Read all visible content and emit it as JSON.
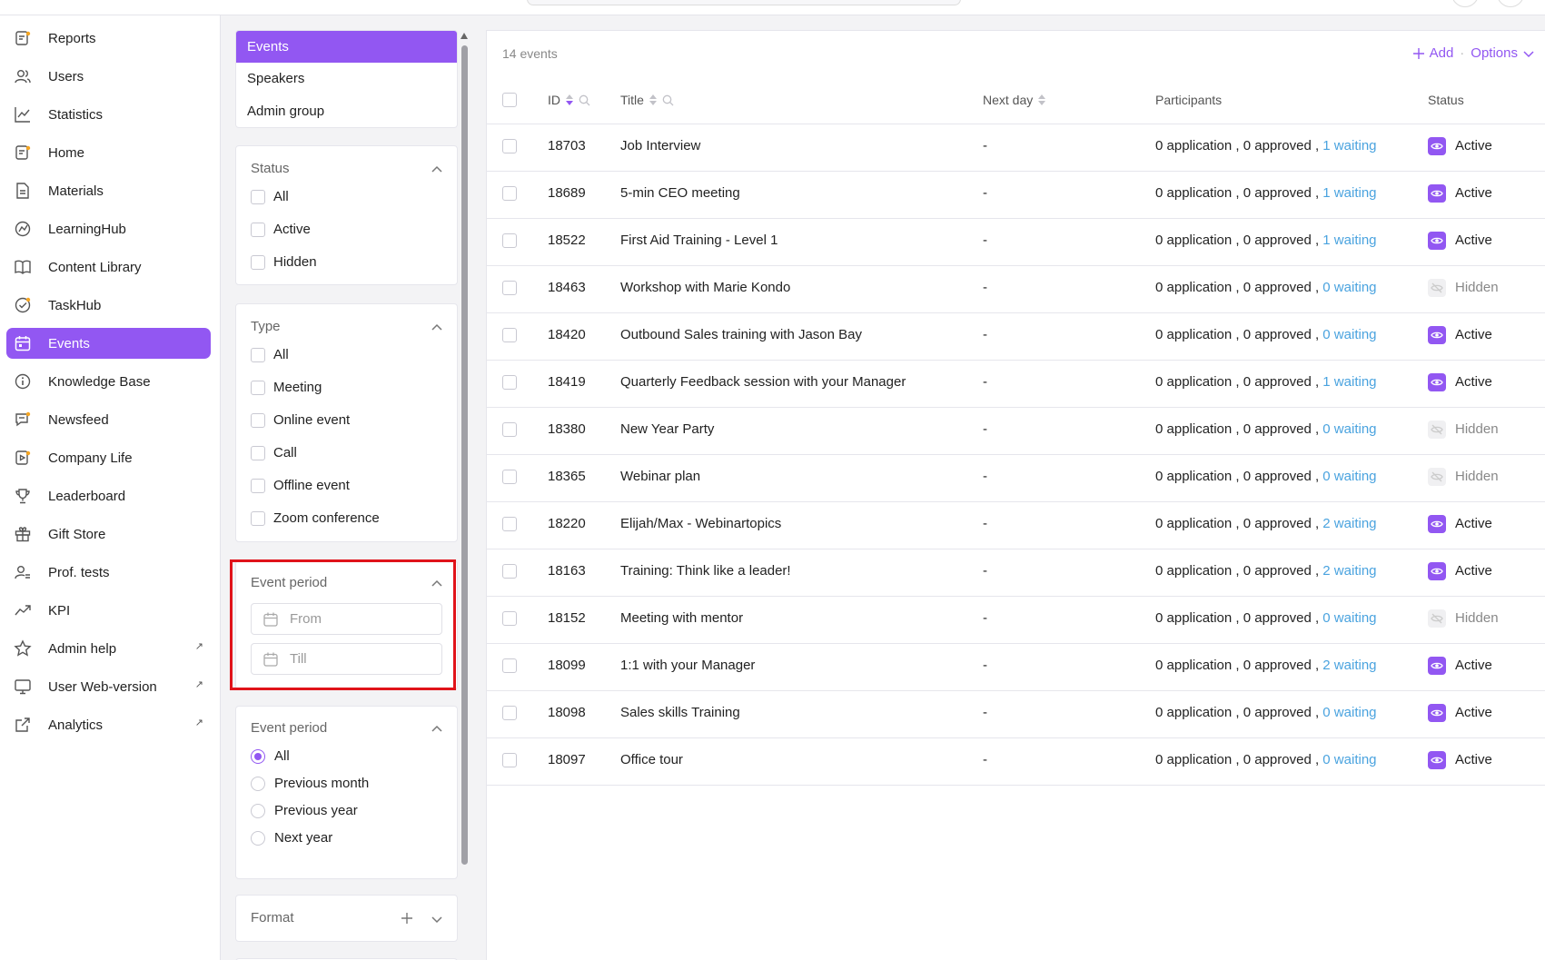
{
  "nav": [
    {
      "label": "Reports",
      "icon": "reports-icon",
      "active": false,
      "external": false
    },
    {
      "label": "Users",
      "icon": "users-icon",
      "active": false,
      "external": false
    },
    {
      "label": "Statistics",
      "icon": "statistics-icon",
      "active": false,
      "external": false
    },
    {
      "label": "Home",
      "icon": "home-icon",
      "active": false,
      "external": false
    },
    {
      "label": "Materials",
      "icon": "materials-icon",
      "active": false,
      "external": false
    },
    {
      "label": "LearningHub",
      "icon": "learninghub-icon",
      "active": false,
      "external": false
    },
    {
      "label": "Content Library",
      "icon": "book-icon",
      "active": false,
      "external": false
    },
    {
      "label": "TaskHub",
      "icon": "taskhub-icon",
      "active": false,
      "external": false
    },
    {
      "label": "Events",
      "icon": "calendar-icon",
      "active": true,
      "external": false
    },
    {
      "label": "Knowledge Base",
      "icon": "info-icon",
      "active": false,
      "external": false
    },
    {
      "label": "Newsfeed",
      "icon": "newsfeed-icon",
      "active": false,
      "external": false
    },
    {
      "label": "Company Life",
      "icon": "video-icon",
      "active": false,
      "external": false
    },
    {
      "label": "Leaderboard",
      "icon": "trophy-icon",
      "active": false,
      "external": false
    },
    {
      "label": "Gift Store",
      "icon": "gift-icon",
      "active": false,
      "external": false
    },
    {
      "label": "Prof. tests",
      "icon": "tests-icon",
      "active": false,
      "external": false
    },
    {
      "label": "KPI",
      "icon": "trend-icon",
      "active": false,
      "external": false
    },
    {
      "label": "Admin help",
      "icon": "star-icon",
      "active": false,
      "external": true
    },
    {
      "label": "User Web-version",
      "icon": "monitor-icon",
      "active": false,
      "external": true
    },
    {
      "label": "Analytics",
      "icon": "external-link-icon",
      "active": false,
      "external": true
    }
  ],
  "segments": [
    "Events",
    "Speakers",
    "Admin group"
  ],
  "filters": {
    "status": {
      "title": "Status",
      "options": [
        "All",
        "Active",
        "Hidden"
      ]
    },
    "type": {
      "title": "Type",
      "options": [
        "All",
        "Meeting",
        "Online event",
        "Call",
        "Offline event",
        "Zoom conference"
      ]
    },
    "event_period_dates": {
      "title": "Event period",
      "from_placeholder": "From",
      "till_placeholder": "Till"
    },
    "event_period": {
      "title": "Event period",
      "options": [
        "All",
        "Previous month",
        "Previous year",
        "Next year"
      ],
      "selected": "All"
    },
    "format": {
      "title": "Format"
    }
  },
  "table": {
    "count_label": "14 events",
    "add_label": "Add",
    "options_label": "Options",
    "columns": {
      "id": "ID",
      "title": "Title",
      "next_day": "Next day",
      "participants": "Participants",
      "status": "Status"
    },
    "rows": [
      {
        "id": "18703",
        "title": "Job Interview",
        "next_day": "-",
        "participants": "0 application , 0 approved ,",
        "waiting": "1 waiting",
        "status": "Active"
      },
      {
        "id": "18689",
        "title": "5-min CEO meeting",
        "next_day": "-",
        "participants": "0 application , 0 approved ,",
        "waiting": "1 waiting",
        "status": "Active"
      },
      {
        "id": "18522",
        "title": "First Aid Training - Level 1",
        "next_day": "-",
        "participants": "0 application , 0 approved ,",
        "waiting": "1 waiting",
        "status": "Active"
      },
      {
        "id": "18463",
        "title": "Workshop with Marie Kondo",
        "next_day": "-",
        "participants": "0 application , 0 approved ,",
        "waiting": "0 waiting",
        "status": "Hidden"
      },
      {
        "id": "18420",
        "title": "Outbound Sales training with Jason Bay",
        "next_day": "-",
        "participants": "0 application , 0 approved ,",
        "waiting": "0 waiting",
        "status": "Active"
      },
      {
        "id": "18419",
        "title": "Quarterly Feedback session with your Manager",
        "next_day": "-",
        "participants": "0 application , 0 approved ,",
        "waiting": "1 waiting",
        "status": "Active"
      },
      {
        "id": "18380",
        "title": "New Year Party",
        "next_day": "-",
        "participants": "0 application , 0 approved ,",
        "waiting": "0 waiting",
        "status": "Hidden"
      },
      {
        "id": "18365",
        "title": "Webinar plan",
        "next_day": "-",
        "participants": "0 application , 0 approved ,",
        "waiting": "0 waiting",
        "status": "Hidden"
      },
      {
        "id": "18220",
        "title": "Elijah/Max - Webinartopics",
        "next_day": "-",
        "participants": "0 application , 0 approved ,",
        "waiting": "2 waiting",
        "status": "Active"
      },
      {
        "id": "18163",
        "title": "Training: Think like a leader!",
        "next_day": "-",
        "participants": "0 application , 0 approved ,",
        "waiting": "2 waiting",
        "status": "Active"
      },
      {
        "id": "18152",
        "title": "Meeting with mentor",
        "next_day": "-",
        "participants": "0 application , 0 approved ,",
        "waiting": "0 waiting",
        "status": "Hidden"
      },
      {
        "id": "18099",
        "title": "1:1 with your Manager",
        "next_day": "-",
        "participants": "0 application , 0 approved ,",
        "waiting": "2 waiting",
        "status": "Active"
      },
      {
        "id": "18098",
        "title": "Sales skills Training",
        "next_day": "-",
        "participants": "0 application , 0 approved ,",
        "waiting": "0 waiting",
        "status": "Active"
      },
      {
        "id": "18097",
        "title": "Office tour",
        "next_day": "-",
        "participants": "0 application , 0 approved ,",
        "waiting": "0 waiting",
        "status": "Active"
      }
    ]
  },
  "colors": {
    "accent": "#9257f2",
    "waiting": "#4aa3df",
    "highlight": "#e0131a"
  }
}
